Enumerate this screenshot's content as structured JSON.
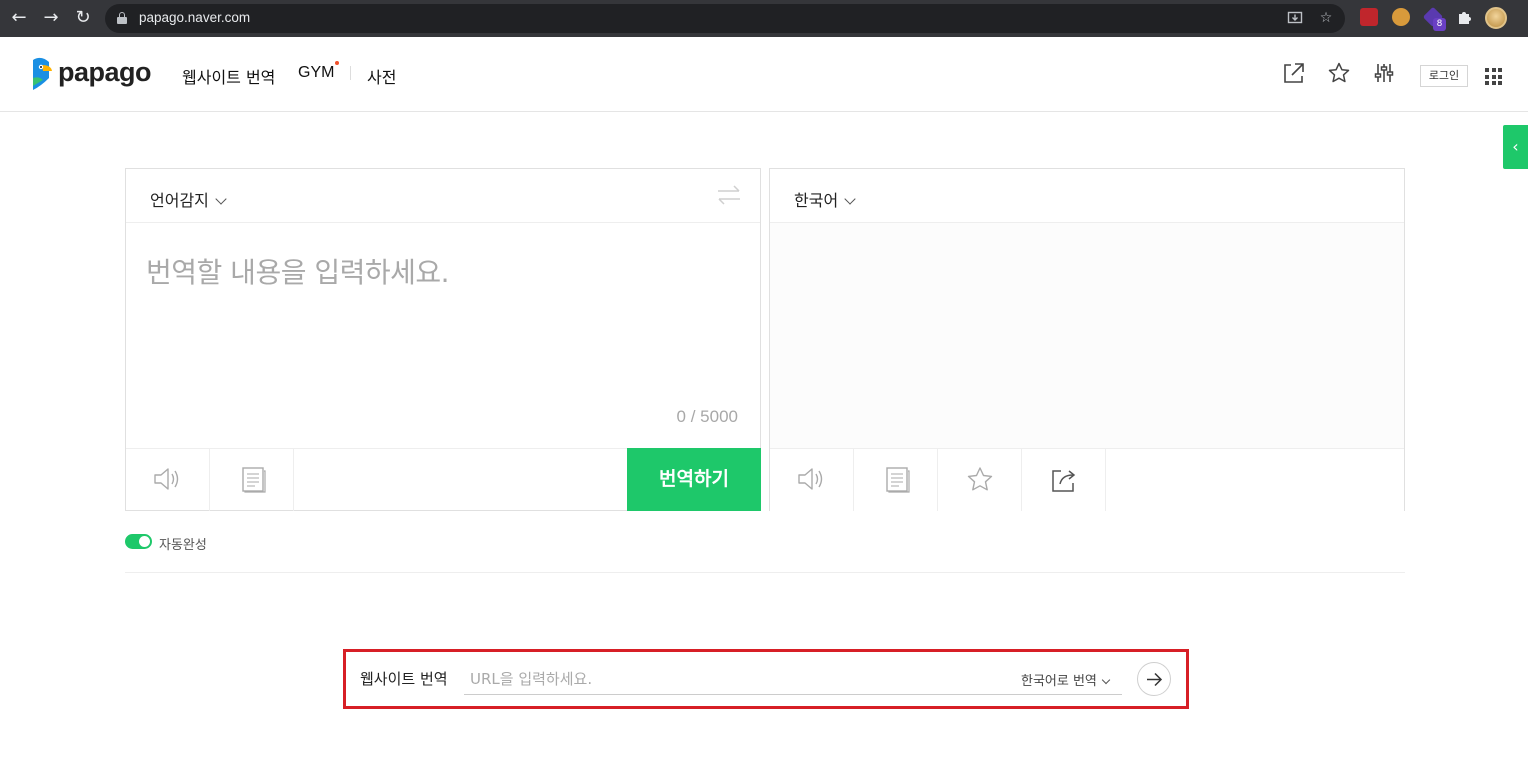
{
  "browser": {
    "url": "papago.naver.com",
    "extension_badge": "8"
  },
  "header": {
    "logo": "papago",
    "menu": [
      {
        "label": "웹사이트 번역"
      },
      {
        "label": "GYM"
      },
      {
        "label": "사전"
      }
    ],
    "login_label": "로그인"
  },
  "source": {
    "language": "언어감지",
    "placeholder": "번역할 내용을 입력하세요.",
    "counter": "0 / 5000",
    "translate_label": "번역하기"
  },
  "target": {
    "language": "한국어"
  },
  "autocomplete": {
    "label": "자동완성",
    "enabled": true
  },
  "website_translate": {
    "label": "웹사이트 번역",
    "placeholder": "URL을 입력하세요.",
    "language": "한국어로 번역"
  },
  "colors": {
    "accent": "#1ec86a",
    "highlight_box": "#d71f26"
  }
}
